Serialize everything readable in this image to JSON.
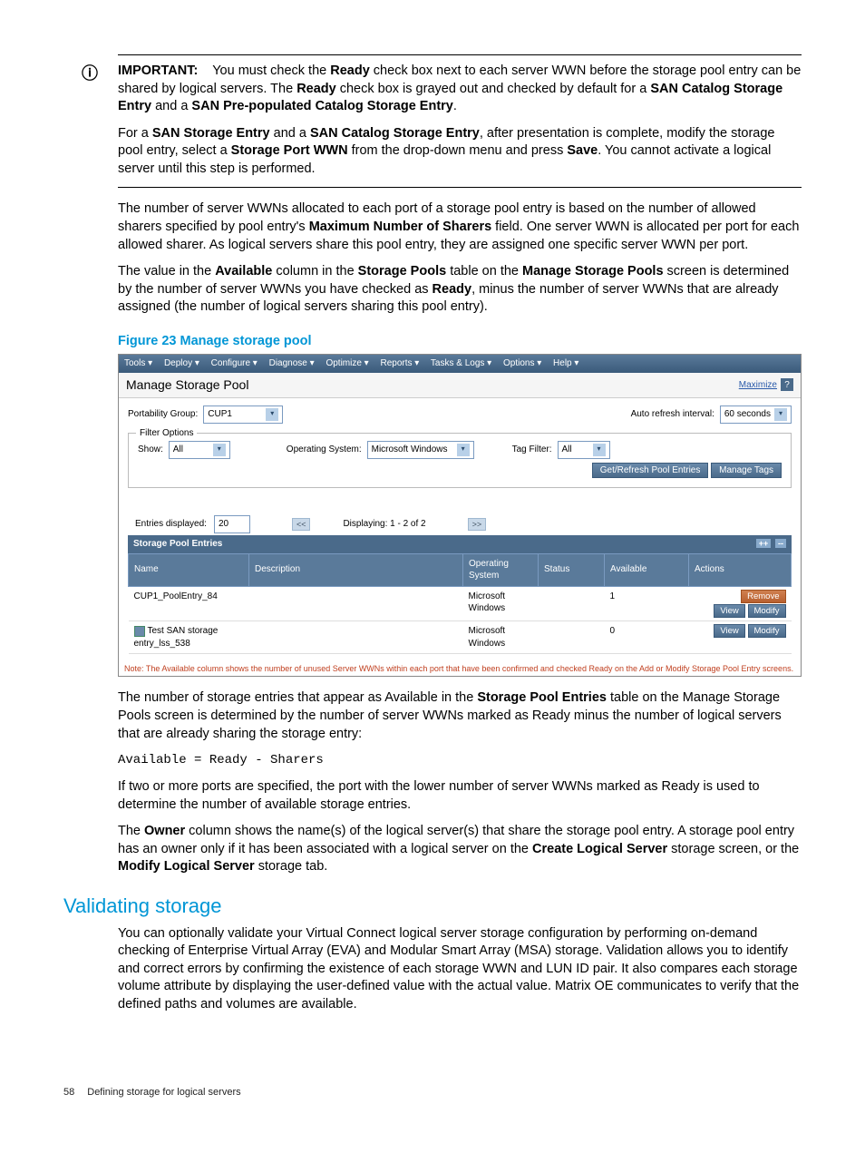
{
  "important": {
    "label": "IMPORTANT:",
    "p1_a": "You must check the ",
    "p1_b": "Ready",
    "p1_c": " check box next to each server WWN before the storage pool entry can be shared by logical servers. The ",
    "p1_d": "Ready",
    "p1_e": " check box is grayed out and checked by default for a ",
    "p1_f": "SAN Catalog Storage Entry",
    "p1_g": " and a ",
    "p1_h": "SAN Pre-populated Catalog Storage Entry",
    "p1_i": ".",
    "p2_a": "For a ",
    "p2_b": "SAN Storage Entry",
    "p2_c": " and a ",
    "p2_d": "SAN Catalog Storage Entry",
    "p2_e": ", after presentation is complete, modify the storage pool entry, select a ",
    "p2_f": "Storage Port WWN",
    "p2_g": " from the drop-down menu and press ",
    "p2_h": "Save",
    "p2_i": ". You cannot activate a logical server until this step is performed."
  },
  "body": {
    "p3_a": "The number of server WWNs allocated to each port of a storage pool entry is based on the number of allowed sharers specified by pool entry's ",
    "p3_b": "Maximum Number of Sharers",
    "p3_c": " field. One server WWN is allocated per port for each allowed sharer. As logical servers share this pool entry, they are assigned one specific server WWN per port.",
    "p4_a": "The value in the ",
    "p4_b": "Available",
    "p4_c": " column in the ",
    "p4_d": "Storage Pools",
    "p4_e": " table on the ",
    "p4_f": "Manage Storage Pools",
    "p4_g": " screen is determined by the number of server WWNs you have checked as ",
    "p4_h": "Ready",
    "p4_i": ", minus the number of server WWNs that are already assigned (the number of logical servers sharing this pool entry).",
    "fig_caption": "Figure 23 Manage storage pool",
    "p5_a": "The number of storage entries that appear as Available in the ",
    "p5_b": "Storage Pool Entries",
    "p5_c": " table on the Manage Storage Pools screen is determined by the number of server WWNs marked as Ready minus the number of logical servers that are already sharing the storage entry:",
    "formula": "Available = Ready - Sharers",
    "p6": "If two or more ports are specified, the port with the lower number of server WWNs marked as Ready is used to determine the number of available storage entries.",
    "p7_a": "The ",
    "p7_b": "Owner",
    "p7_c": " column shows the name(s) of the logical server(s) that share the storage pool entry. A storage pool entry has an owner only if it has been associated with a logical server on the ",
    "p7_d": "Create Logical Server",
    "p7_e": " storage screen, or the ",
    "p7_f": "Modify Logical Server",
    "p7_g": " storage tab."
  },
  "section": {
    "title": "Validating storage",
    "p": "You can optionally validate your Virtual Connect logical server storage configuration by performing on-demand checking of Enterprise Virtual Array (EVA) and Modular Smart Array (MSA) storage. Validation allows you to identify and correct errors by confirming the existence of each storage WWN and LUN ID pair. It also compares each storage volume attribute by displaying the user-defined value with the actual value. Matrix OE communicates to verify that the defined paths and volumes are available."
  },
  "screenshot": {
    "menubar": [
      "Tools ▾",
      "Deploy ▾",
      "Configure ▾",
      "Diagnose ▾",
      "Optimize ▾",
      "Reports ▾",
      "Tasks & Logs ▾",
      "Options ▾",
      "Help ▾"
    ],
    "title": "Manage Storage Pool",
    "maximize": "Maximize",
    "portability_label": "Portability Group:",
    "portability_value": "CUP1",
    "auto_refresh_label": "Auto refresh interval:",
    "auto_refresh_value": "60 seconds",
    "filter_legend": "Filter Options",
    "show_label": "Show:",
    "show_value": "All",
    "os_label": "Operating System:",
    "os_value": "Microsoft Windows",
    "tag_label": "Tag Filter:",
    "tag_value": "All",
    "get_refresh": "Get/Refresh Pool Entries",
    "manage_tags": "Manage Tags",
    "entries_disp_label": "Entries displayed:",
    "entries_disp_value": "20",
    "displaying": "Displaying: 1 - 2 of 2",
    "sp_header": "Storage Pool Entries",
    "columns": {
      "name": "Name",
      "desc": "Description",
      "os": "Operating System",
      "status": "Status",
      "avail": "Available",
      "actions": "Actions"
    },
    "rows": [
      {
        "name": "CUP1_PoolEntry_84",
        "desc": "",
        "os": "Microsoft Windows",
        "status": "",
        "avail": "1",
        "remove": "Remove",
        "view": "View",
        "modify": "Modify"
      },
      {
        "name": "Test SAN storage entry_lss_538",
        "desc": "",
        "os": "Microsoft Windows",
        "status": "",
        "avail": "0",
        "view": "View",
        "modify": "Modify",
        "has_icon": true
      }
    ],
    "note": "Note: The Available column shows the number of unused Server WWNs within each port that have been confirmed and checked Ready on the Add or Modify Storage Pool Entry screens."
  },
  "footer": {
    "page": "58",
    "chapter": "Defining storage for logical servers"
  }
}
